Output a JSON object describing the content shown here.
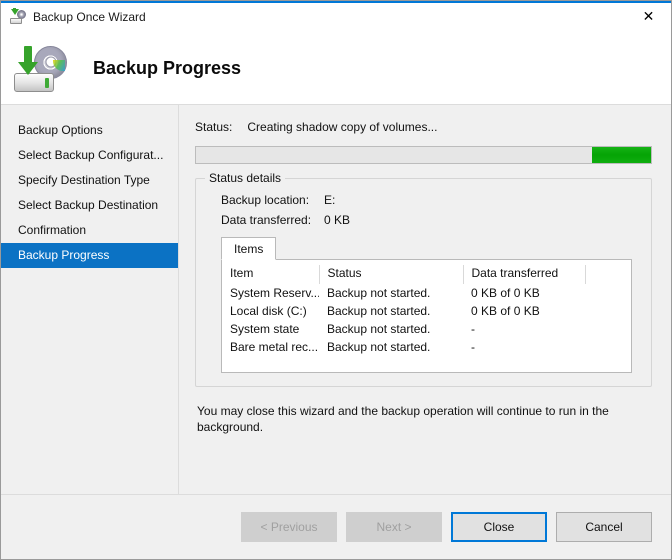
{
  "window": {
    "title": "Backup Once Wizard",
    "title_icon": "backup-disk-icon",
    "close_label": "✕"
  },
  "header": {
    "title": "Backup Progress",
    "icon": "backup-drive-disc-icon"
  },
  "sidebar": {
    "items": [
      {
        "label": "Backup Options",
        "selected": false
      },
      {
        "label": "Select Backup Configurat...",
        "selected": false
      },
      {
        "label": "Specify Destination Type",
        "selected": false
      },
      {
        "label": "Select Backup Destination",
        "selected": false
      },
      {
        "label": "Confirmation",
        "selected": false
      },
      {
        "label": "Backup Progress",
        "selected": true
      }
    ]
  },
  "main": {
    "status_label": "Status:",
    "status_value": "Creating shadow copy of volumes...",
    "progress": {
      "style": "marquee",
      "chunk_left_pct": 87,
      "chunk_width_pct": 13,
      "color": "#06a506",
      "track_color": "#e6e6e6"
    },
    "status_details": {
      "legend": "Status details",
      "fields": [
        {
          "key": "Backup location:",
          "value": "E:"
        },
        {
          "key": "Data transferred:",
          "value": "0 KB"
        }
      ],
      "tabs": [
        {
          "label": "Items",
          "selected": true
        }
      ],
      "table": {
        "columns": [
          "Item",
          "Status",
          "Data transferred",
          ""
        ],
        "rows": [
          [
            "System Reserv...",
            "Backup not started.",
            "0 KB of 0 KB",
            ""
          ],
          [
            "Local disk (C:)",
            "Backup not started.",
            "0 KB of 0 KB",
            ""
          ],
          [
            "System state",
            "Backup not started.",
            "-",
            ""
          ],
          [
            "Bare metal rec...",
            "Backup not started.",
            "-",
            ""
          ]
        ]
      }
    },
    "note": "You may close this wizard and the backup operation will continue to run in the background."
  },
  "footer": {
    "buttons": [
      {
        "label": "< Previous",
        "state": "disabled"
      },
      {
        "label": "Next >",
        "state": "disabled"
      },
      {
        "label": "Close",
        "state": "default"
      },
      {
        "label": "Cancel",
        "state": "normal"
      }
    ]
  },
  "colors": {
    "accent": "#0078d7",
    "selection": "#0b72c4",
    "progress_green": "#06a506",
    "window_bg": "#f0f0f0"
  }
}
